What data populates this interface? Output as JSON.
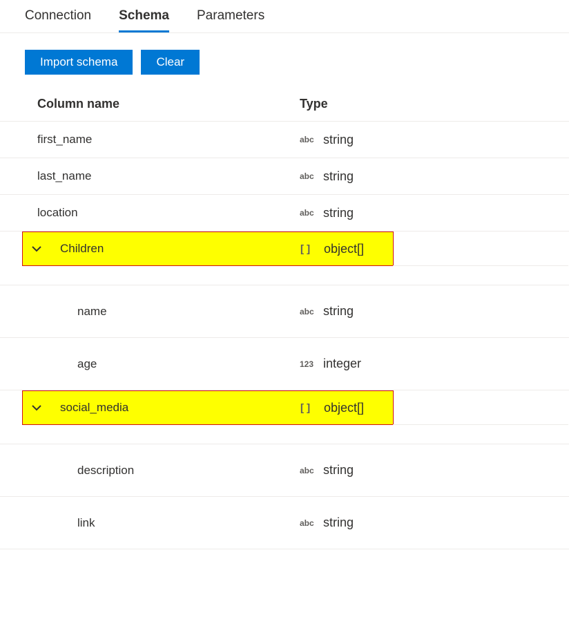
{
  "tabs": {
    "connection": "Connection",
    "schema": "Schema",
    "parameters": "Parameters"
  },
  "toolbar": {
    "import_label": "Import schema",
    "clear_label": "Clear"
  },
  "headers": {
    "name": "Column name",
    "type": "Type"
  },
  "type_icons": {
    "string": "abc",
    "integer": "123",
    "object_array": "[ ]"
  },
  "types": {
    "string": "string",
    "integer": "integer",
    "object_array": "object[]"
  },
  "columns": {
    "first_name": "first_name",
    "last_name": "last_name",
    "location": "location",
    "children": "Children",
    "children_name": "name",
    "children_age": "age",
    "social_media": "social_media",
    "social_description": "description",
    "social_link": "link"
  }
}
